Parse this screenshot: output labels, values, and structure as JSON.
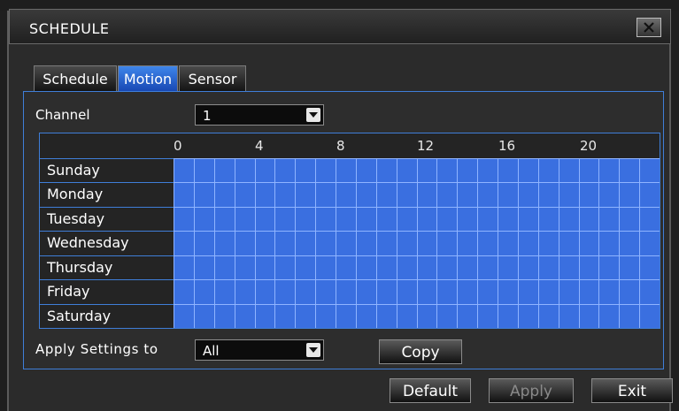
{
  "window": {
    "title": "SCHEDULE"
  },
  "tabs": [
    {
      "label": "Schedule",
      "active": false
    },
    {
      "label": "Motion",
      "active": true
    },
    {
      "label": "Sensor",
      "active": false
    }
  ],
  "channel": {
    "label": "Channel",
    "value": "1"
  },
  "schedule_grid": {
    "hour_labels": [
      "0",
      "4",
      "8",
      "12",
      "16",
      "20"
    ],
    "days": [
      "Sunday",
      "Monday",
      "Tuesday",
      "Wednesday",
      "Thursday",
      "Friday",
      "Saturday"
    ],
    "cell_color": "#3a6fe0",
    "line_color": "#8fb4ff"
  },
  "apply_settings": {
    "label": "Apply Settings to",
    "value": "All",
    "copy_label": "Copy"
  },
  "buttons": {
    "default_label": "Default",
    "apply_label": "Apply",
    "exit_label": "Exit"
  },
  "icons": {
    "close": "close-icon",
    "dropdown": "chevron-down-icon"
  }
}
